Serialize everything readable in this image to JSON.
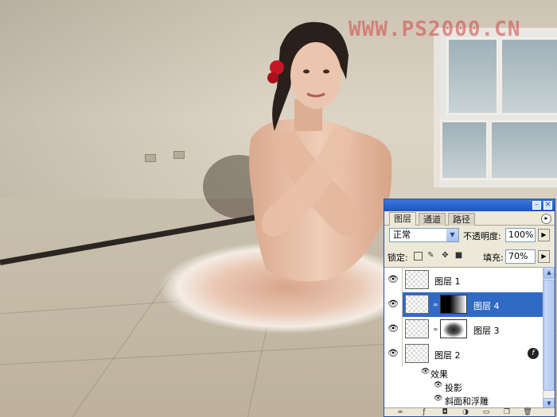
{
  "watermark": "WWW.PS2000.CN",
  "palette": {
    "tabs": [
      {
        "label": "图层",
        "active": true
      },
      {
        "label": "通道",
        "active": false
      },
      {
        "label": "路径",
        "active": false
      }
    ],
    "blend_mode": "正常",
    "opacity_label": "不透明度:",
    "opacity_value": "100%",
    "lock_label": "锁定:",
    "fill_label": "填充:",
    "fill_value": "70%",
    "layers": [
      {
        "name": "图层 1",
        "selected": false,
        "has_mask": false,
        "fx": false
      },
      {
        "name": "图层 4",
        "selected": true,
        "has_mask": true,
        "fx": false
      },
      {
        "name": "图层 3",
        "selected": false,
        "has_mask": true,
        "fx": false
      },
      {
        "name": "图层 2",
        "selected": false,
        "has_mask": false,
        "fx": true
      }
    ],
    "effects_label": "效果",
    "effects": [
      "投影",
      "斜面和浮雕"
    ],
    "selection_color": "#316ac5",
    "titlebar_color": "#1e55c2"
  }
}
